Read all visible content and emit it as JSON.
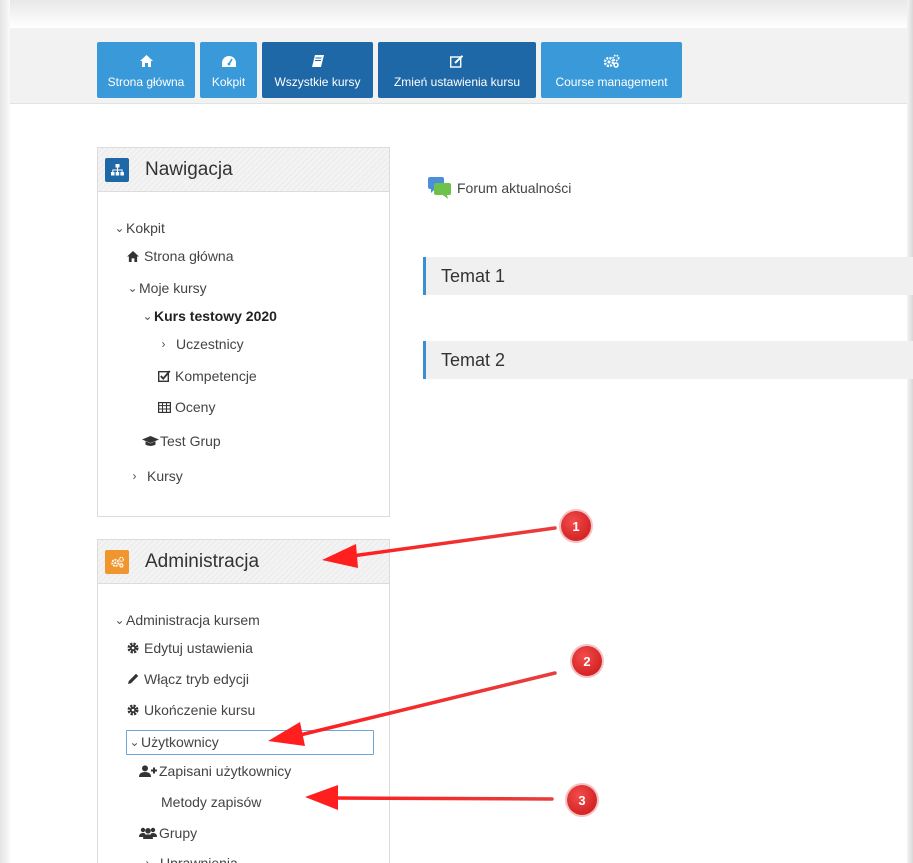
{
  "topnav": {
    "items": [
      {
        "label": "Strona główna",
        "icon": "home-icon"
      },
      {
        "label": "Kokpit",
        "icon": "dashboard-icon"
      },
      {
        "label": "Wszystkie kursy",
        "icon": "book-icon"
      },
      {
        "label": "Zmień ustawienia kursu",
        "icon": "edit-icon"
      },
      {
        "label": "Course management",
        "icon": "cogs-icon"
      }
    ]
  },
  "navigation": {
    "title": "Nawigacja",
    "items": [
      {
        "label": "Kokpit"
      },
      {
        "label": "Strona główna"
      },
      {
        "label": "Moje kursy"
      },
      {
        "label": "Kurs testowy 2020"
      },
      {
        "label": "Uczestnicy"
      },
      {
        "label": "Kompetencje"
      },
      {
        "label": "Oceny"
      },
      {
        "label": "Test Grup"
      },
      {
        "label": "Kursy"
      }
    ]
  },
  "administration": {
    "title": "Administracja",
    "items": [
      {
        "label": "Administracja kursem"
      },
      {
        "label": "Edytuj ustawienia"
      },
      {
        "label": "Włącz tryb edycji"
      },
      {
        "label": "Ukończenie kursu"
      },
      {
        "label": "Użytkownicy"
      },
      {
        "label": "Zapisani użytkownicy"
      },
      {
        "label": "Metody zapisów"
      },
      {
        "label": "Grupy"
      },
      {
        "label": "Uprawnienia"
      }
    ]
  },
  "main": {
    "forum_label": "Forum aktualności",
    "sections": [
      {
        "title": "Temat 1"
      },
      {
        "title": "Temat 2"
      }
    ]
  },
  "annotations": {
    "badges": [
      "1",
      "2",
      "3"
    ]
  },
  "colors": {
    "nav_light": "#3a9ad9",
    "nav_dark": "#1f68a8",
    "nav_block_icon": "#1f68a8",
    "admin_block_icon": "#f0962e",
    "annotation_red": "#e31b1b"
  }
}
